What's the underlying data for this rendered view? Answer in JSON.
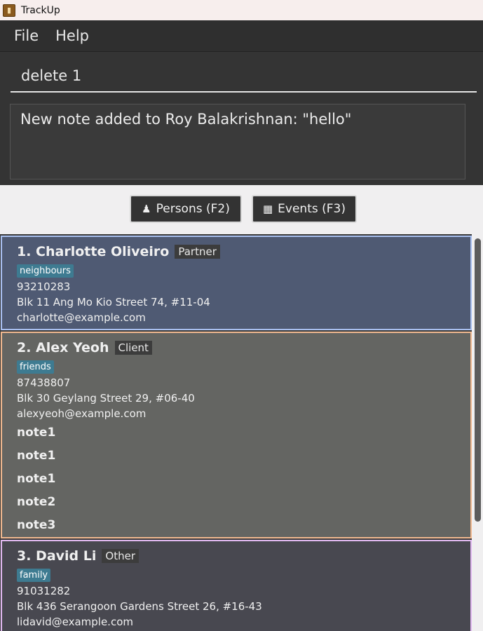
{
  "window": {
    "title": "TrackUp"
  },
  "menu": {
    "file": "File",
    "help": "Help"
  },
  "command": {
    "value": "delete 1"
  },
  "result": {
    "text": "New note added to Roy Balakrishnan: \"hello\""
  },
  "tabs": {
    "persons": "Persons (F2)",
    "events": "Events (F3)"
  },
  "persons": [
    {
      "name": "1. Charlotte Oliveiro",
      "role": "Partner",
      "tag": "neighbours",
      "phone": "93210283",
      "address": "Blk 11 Ang Mo Kio Street 74, #11-04",
      "email": "charlotte@example.com",
      "notes": []
    },
    {
      "name": "2. Alex Yeoh",
      "role": "Client",
      "tag": "friends",
      "phone": "87438807",
      "address": "Blk 30 Geylang Street 29, #06-40",
      "email": "alexyeoh@example.com",
      "notes": [
        "note1",
        "note1",
        "note1",
        "note2",
        "note3"
      ]
    },
    {
      "name": "3. David Li",
      "role": "Other",
      "tag": "family",
      "phone": "91031282",
      "address": "Blk 436 Serangoon Gardens Street 26, #16-43",
      "email": "lidavid@example.com",
      "notes": []
    }
  ],
  "colors": {
    "card1_bg": "#4f5a73",
    "card1_border": "#a9c0f0",
    "card2_bg": "#646562",
    "card2_border": "#f0b890",
    "card3_bg": "#484850",
    "card3_border": "#e0b8f0",
    "tag_bg": "#3e7b91"
  },
  "icons": {
    "app": "app-icon",
    "persons": "person-icon",
    "events": "calendar-icon"
  }
}
